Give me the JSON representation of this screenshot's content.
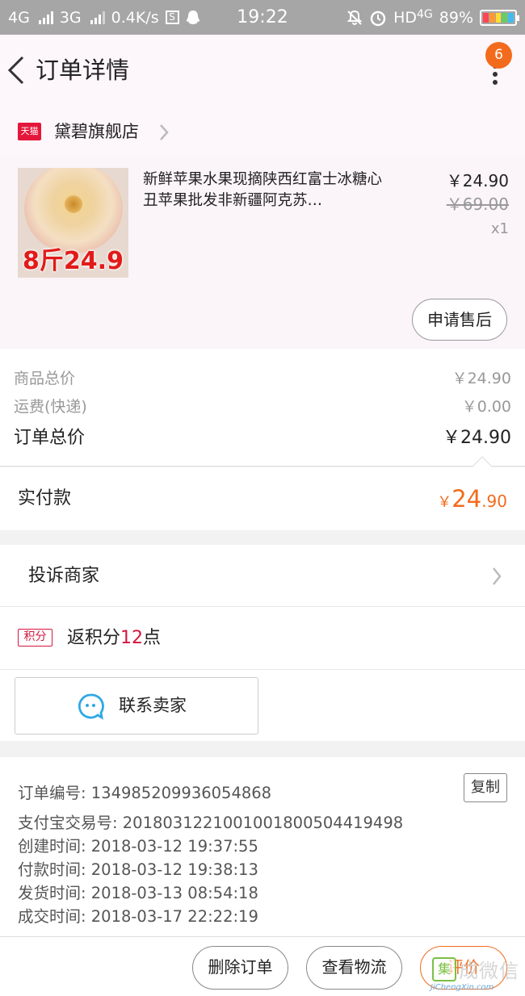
{
  "status_bar": {
    "network1": "4G",
    "network2": "3G",
    "speed": "0.4K/s",
    "s_icon_text": "S",
    "time": "19:22",
    "hd": "HD",
    "network3": "4G",
    "battery": "89%"
  },
  "header": {
    "title": "订单详情",
    "badge_count": "6"
  },
  "shop": {
    "tag": "天猫",
    "name": "黛碧旗舰店"
  },
  "product": {
    "image_label": "8斤24.9",
    "title": "新鲜苹果水果现摘陕西红富士冰糖心丑苹果批发非新疆阿克苏…",
    "price": "￥24.90",
    "original_price": "￥69.00",
    "quantity": "x1",
    "after_sale_label": "申请售后"
  },
  "totals": {
    "goods_label": "商品总价",
    "goods_value": "￥24.90",
    "shipping_label": "运费(快递)",
    "shipping_value": "￥0.00",
    "order_total_label": "订单总价",
    "order_total_value": "￥24.90",
    "paid_label": "实付款",
    "paid_currency": "￥",
    "paid_integer": "24",
    "paid_decimal": ".90"
  },
  "complaint": {
    "label": "投诉商家"
  },
  "points": {
    "tag": "积分",
    "text_prefix": "返积分",
    "count": "12",
    "text_suffix": "点"
  },
  "contact": {
    "label": "联系卖家"
  },
  "order_info": {
    "order_no": "订单编号: 134985209936054868",
    "copy_label": "复制",
    "alipay_no": "支付宝交易号: 2018031221001001800504419498",
    "created": "创建时间: 2018-03-12 19:37:55",
    "paid": "付款时间: 2018-03-12 19:38:13",
    "shipped": "发货时间: 2018-03-13 08:54:18",
    "completed": "成交时间: 2018-03-17 22:22:19"
  },
  "actions": {
    "delete": "删除订单",
    "logistics": "查看物流",
    "review": "评价"
  },
  "watermark": {
    "icon": "集",
    "text": "成微信",
    "url": "JiChengXin.com"
  },
  "colors": {
    "accent_orange": "#f26b1d",
    "tmall_red": "#e4173b",
    "points_red": "#d3173f"
  }
}
